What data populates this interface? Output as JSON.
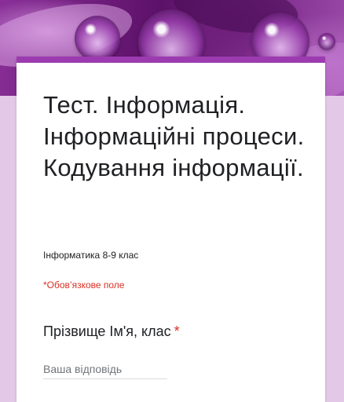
{
  "theme": {
    "accent": "#9c3bb0",
    "page_background": "#e3c9e7",
    "required_color": "#d93025"
  },
  "form": {
    "title": "Тест. Інформація. Інформаційні процеси. Кодування інформації.",
    "description": "Інформатика 8-9 клас",
    "required_note": "*Обов’язкове поле"
  },
  "questions": [
    {
      "title": "Прізвище Ім'я, клас",
      "required_marker": "*",
      "placeholder": "Ваша відповідь"
    }
  ]
}
